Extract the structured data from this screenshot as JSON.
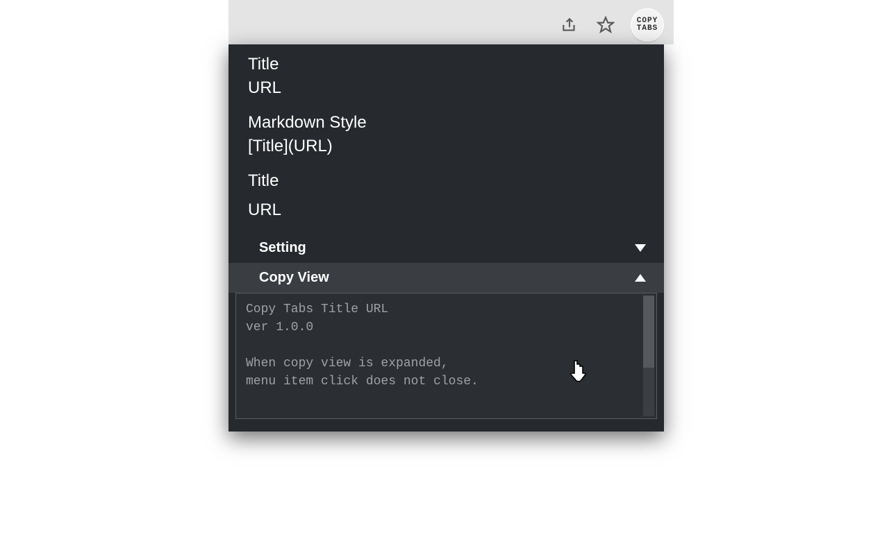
{
  "toolbar": {
    "extension_label": "COPY\nTABS"
  },
  "popup": {
    "menu": [
      {
        "line1": "Title",
        "line2": "URL"
      },
      {
        "line1": "Markdown Style",
        "line2": "[Title](URL)"
      },
      {
        "line1": "Title"
      },
      {
        "line1": "URL"
      }
    ],
    "sections": {
      "setting_label": "Setting",
      "copyview_label": "Copy View"
    },
    "copy_view_text": "Copy Tabs Title URL\nver 1.0.0\n\nWhen copy view is expanded,\nmenu item click does not close."
  }
}
